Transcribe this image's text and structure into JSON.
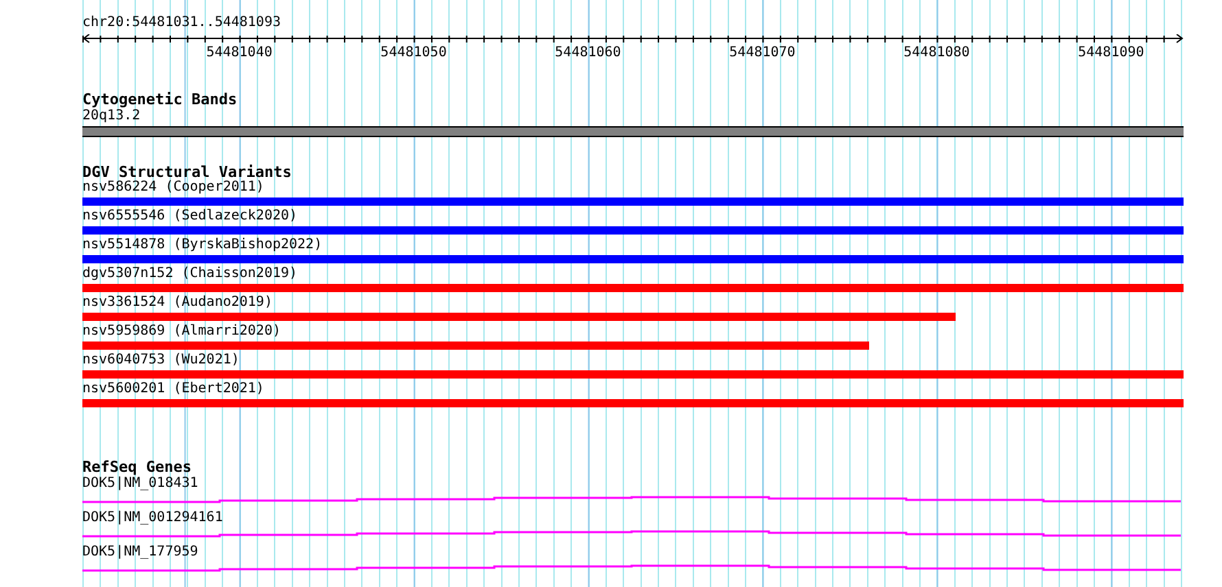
{
  "location": "chr20:54481031..54481093",
  "ruler": {
    "labels": [
      "54481040",
      "54481050",
      "54481060",
      "54481070",
      "54481080",
      "54481090"
    ]
  },
  "cytogenetic": {
    "title": "Cytogenetic Bands",
    "band": "20q13.2"
  },
  "variants": {
    "title": "DGV Structural Variants",
    "items": [
      {
        "label": "nsv586224 (Cooper2011)",
        "color": "#0000ff",
        "level": 1
      },
      {
        "label": "nsv6555546 (Sedlazeck2020)",
        "color": "#0000ff",
        "level": 1
      },
      {
        "label": "nsv5514878 (ByrskaBishop2022)",
        "color": "#0000ff",
        "level": 1
      },
      {
        "label": "dgv5307n152 (Chaisson2019)",
        "color": "#ff0000",
        "level": 1
      },
      {
        "label": "nsv3361524 (Audano2019)",
        "color": "#ff0000",
        "level": 0.793
      },
      {
        "label": "nsv5959869 (Almarri2020)",
        "color": "#ff0000",
        "level": 0.714
      },
      {
        "label": "nsv6040753 (Wu2021)",
        "color": "#ff0000",
        "level": 1
      },
      {
        "label": "nsv5600201 (Ebert2021)",
        "color": "#ff0000",
        "level": 1
      }
    ]
  },
  "genes": {
    "title": "RefSeq Genes",
    "items": [
      {
        "label": "DOK5|NM_018431"
      },
      {
        "label": "DOK5|NM_001294161"
      },
      {
        "label": "DOK5|NM_177959"
      }
    ]
  }
}
